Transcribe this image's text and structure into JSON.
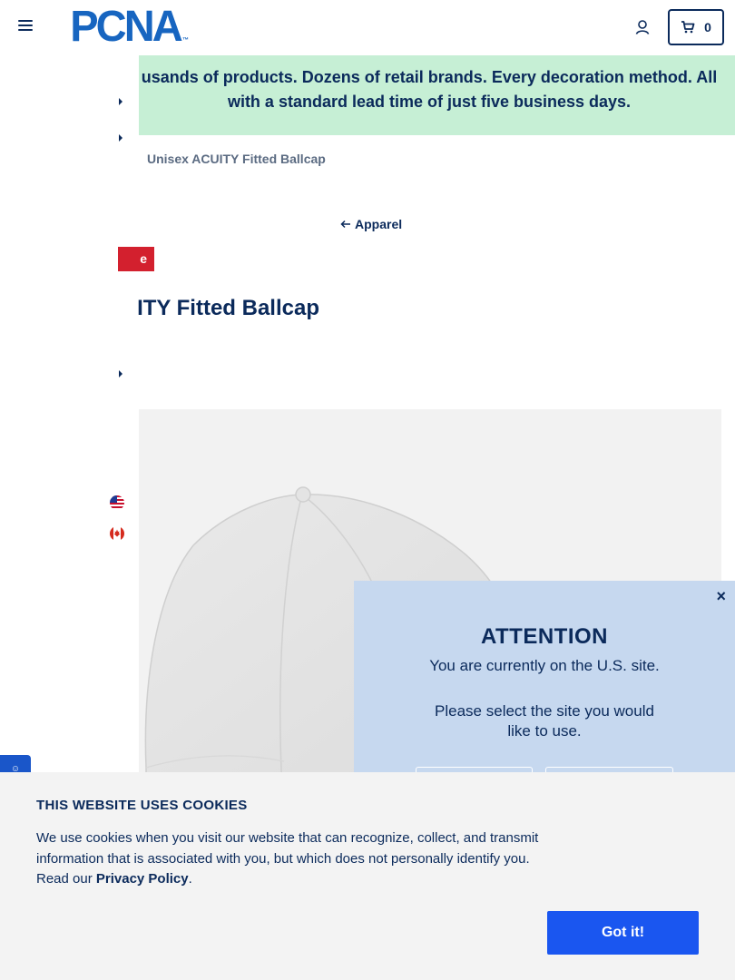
{
  "header": {
    "logo_text": "PCNA",
    "logo_tm": "™",
    "cart_count": "0"
  },
  "banner": {
    "line1": "usands of products. Dozens of retail brands. Every decoration method. All",
    "line2": "with a standard lead time of just five business days."
  },
  "breadcrumb": {
    "current": "Unisex ACUITY Fitted Ballcap"
  },
  "back_link": {
    "label": "Apparel"
  },
  "product": {
    "badge": "e",
    "title": "ITY Fitted Ballcap"
  },
  "attention": {
    "close": "×",
    "title": "ATTENTION",
    "message": "You are currently on the U.S. site.",
    "prompt": "Please select the site you would like to use."
  },
  "feedback": {
    "label": "☺"
  },
  "cookie": {
    "title": "THIS WEBSITE USES COOKIES",
    "body": "We use cookies when you visit our website that can recognize, collect, and transmit information that is associated with you, but which does not personally identify you. Read our ",
    "policy_link": "Privacy Policy",
    "body_end": ".",
    "button": "Got it!"
  },
  "colors": {
    "navy": "#0b2a5b",
    "brand_blue": "#1765c0",
    "banner_green": "#c6efd5",
    "modal_blue": "#c6d8ef",
    "sale_red": "#d3202e",
    "button_blue": "#1a56f0"
  },
  "icons": {
    "menu": "hamburger-icon",
    "account": "user-icon",
    "cart": "cart-icon",
    "back": "arrow-left-icon",
    "us_flag": "us-flag-icon",
    "ca_flag": "canada-flag-icon"
  }
}
